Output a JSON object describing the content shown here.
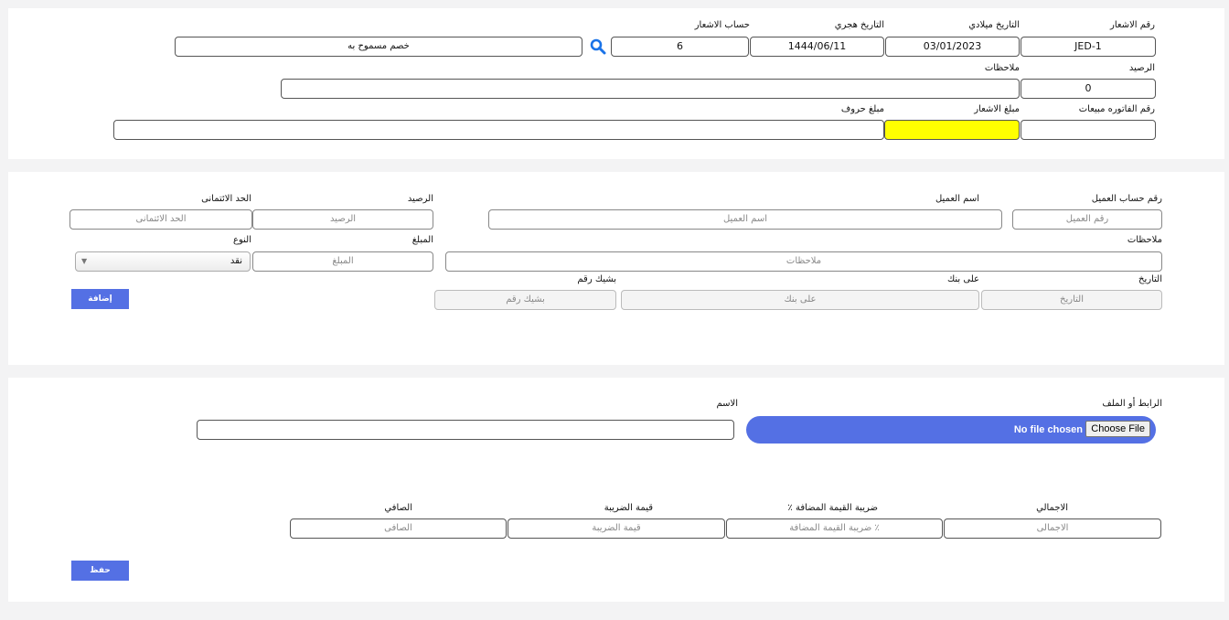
{
  "header": {
    "labels": {
      "notice_no": "رقم الاشعار",
      "date_gregorian": "التاريخ ميلادي",
      "date_hijri": "التاريخ هجري",
      "notice_account": "حساب الاشعار",
      "balance": "الرصيد",
      "notes": "ملاحظات",
      "sales_invoice_no": "رقم الفاتوره مبيعات",
      "notice_amount": "مبلغ الاشعار",
      "amount_words": "مبلغ حروف"
    },
    "values": {
      "notice_no": "JED-1",
      "date_gregorian": "03/01/2023",
      "date_hijri": "1444/06/11",
      "notice_account": "6",
      "account_name": "خصم مسموح به",
      "balance": "0",
      "notes": "",
      "sales_invoice_no": "",
      "notice_amount": "",
      "amount_words": ""
    }
  },
  "customer": {
    "labels": {
      "account_no": "رقم حساب العميل",
      "name": "اسم العميل",
      "balance": "الرصيد",
      "credit_limit": "الحد الائتمانى",
      "notes": "ملاحظات",
      "amount": "المبلغ",
      "type": "النوع",
      "date": "التاريخ",
      "bank": "على بنك",
      "cheque_no": "بشيك رقم"
    },
    "placeholders": {
      "account_no": "رقم العميل",
      "name": "اسم العميل",
      "balance": "الرصيد",
      "credit_limit": "الحد الائتمانى",
      "notes": "ملاحظات",
      "amount": "المبلغ",
      "date": "التاريخ",
      "bank": "على بنك",
      "cheque_no": "بشيك رقم"
    },
    "type_selected": "نقد",
    "add_button": "إضافة"
  },
  "attachments": {
    "labels": {
      "link_or_file": "الرابط أو الملف",
      "name": "الاسم",
      "total": "الاجمالي",
      "vat_percent": "ضريبة القيمة المضافة ٪",
      "tax_value": "قيمة الضريبة",
      "net": "الصافي"
    },
    "file_status": "No file chosen",
    "choose_file": "Choose File",
    "name_value": "",
    "placeholders": {
      "total": "الاجمالى",
      "vat_percent": "ضريبة القيمة المضافة ٪",
      "tax_value": "قيمة الضريبة",
      "net": "الصافى"
    },
    "save_button": "حفظ"
  },
  "colors": {
    "accent": "#5470e4",
    "highlight": "#ffff00",
    "icon": "#1a73e8"
  }
}
